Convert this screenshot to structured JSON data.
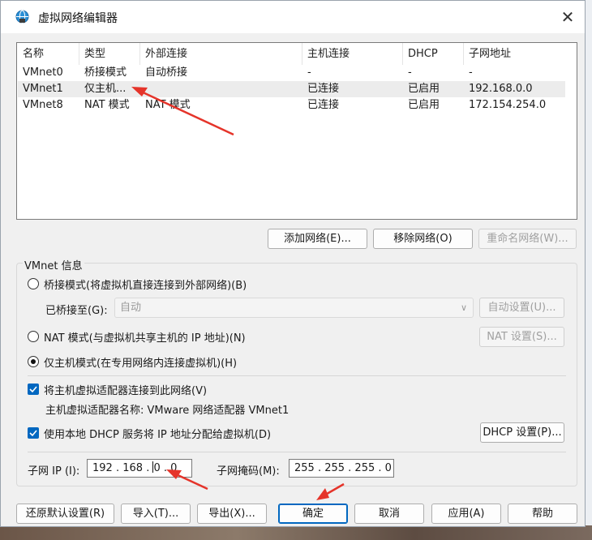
{
  "window": {
    "title": "虚拟网络编辑器",
    "close_glyph": "✕"
  },
  "table": {
    "columns": [
      "名称",
      "类型",
      "外部连接",
      "主机连接",
      "DHCP",
      "子网地址"
    ],
    "rows": [
      {
        "name": "VMnet0",
        "type": "桥接模式",
        "external": "自动桥接",
        "host": "-",
        "dhcp": "-",
        "subnet": "-"
      },
      {
        "name": "VMnet1",
        "type": "仅主机...",
        "external": "",
        "host": "已连接",
        "dhcp": "已启用",
        "subnet": "192.168.0.0"
      },
      {
        "name": "VMnet8",
        "type": "NAT 模式",
        "external": "NAT 模式",
        "host": "已连接",
        "dhcp": "已启用",
        "subnet": "172.154.254.0"
      }
    ],
    "selected_index": 1
  },
  "list_buttons": {
    "add": "添加网络(E)...",
    "remove": "移除网络(O)",
    "rename": "重命名网络(W)..."
  },
  "vmnet_info": {
    "group_label": "VMnet 信息",
    "bridge_label": "桥接模式(将虚拟机直接连接到外部网络)(B)",
    "bridged_to_label": "已桥接至(G):",
    "bridged_to_value": "自动",
    "auto_settings": "自动设置(U)...",
    "nat_label": "NAT 模式(与虚拟机共享主机的 IP 地址)(N)",
    "nat_settings": "NAT 设置(S)...",
    "hostonly_label": "仅主机模式(在专用网络内连接虚拟机)(H)",
    "selected_mode": "hostonly",
    "connect_adapter_label": "将主机虚拟适配器连接到此网络(V)",
    "connect_adapter_checked": true,
    "adapter_name_label": "主机虚拟适配器名称: VMware 网络适配器 VMnet1",
    "dhcp_label": "使用本地 DHCP 服务将 IP 地址分配给虚拟机(D)",
    "dhcp_checked": true,
    "dhcp_settings": "DHCP 设置(P)...",
    "subnet_ip_label": "子网 IP (I):",
    "subnet_ip": [
      "192",
      "168",
      "0",
      "0"
    ],
    "subnet_mask_label": "子网掩码(M):",
    "subnet_mask": "255 . 255 . 255 . 0"
  },
  "footer_buttons": {
    "restore": "还原默认设置(R)",
    "import": "导入(T)...",
    "export": "导出(X)...",
    "ok": "确定",
    "cancel": "取消",
    "apply": "应用(A)",
    "help": "帮助"
  },
  "colors": {
    "accent": "#0067c0",
    "annotation_arrow": "#e5342a"
  }
}
